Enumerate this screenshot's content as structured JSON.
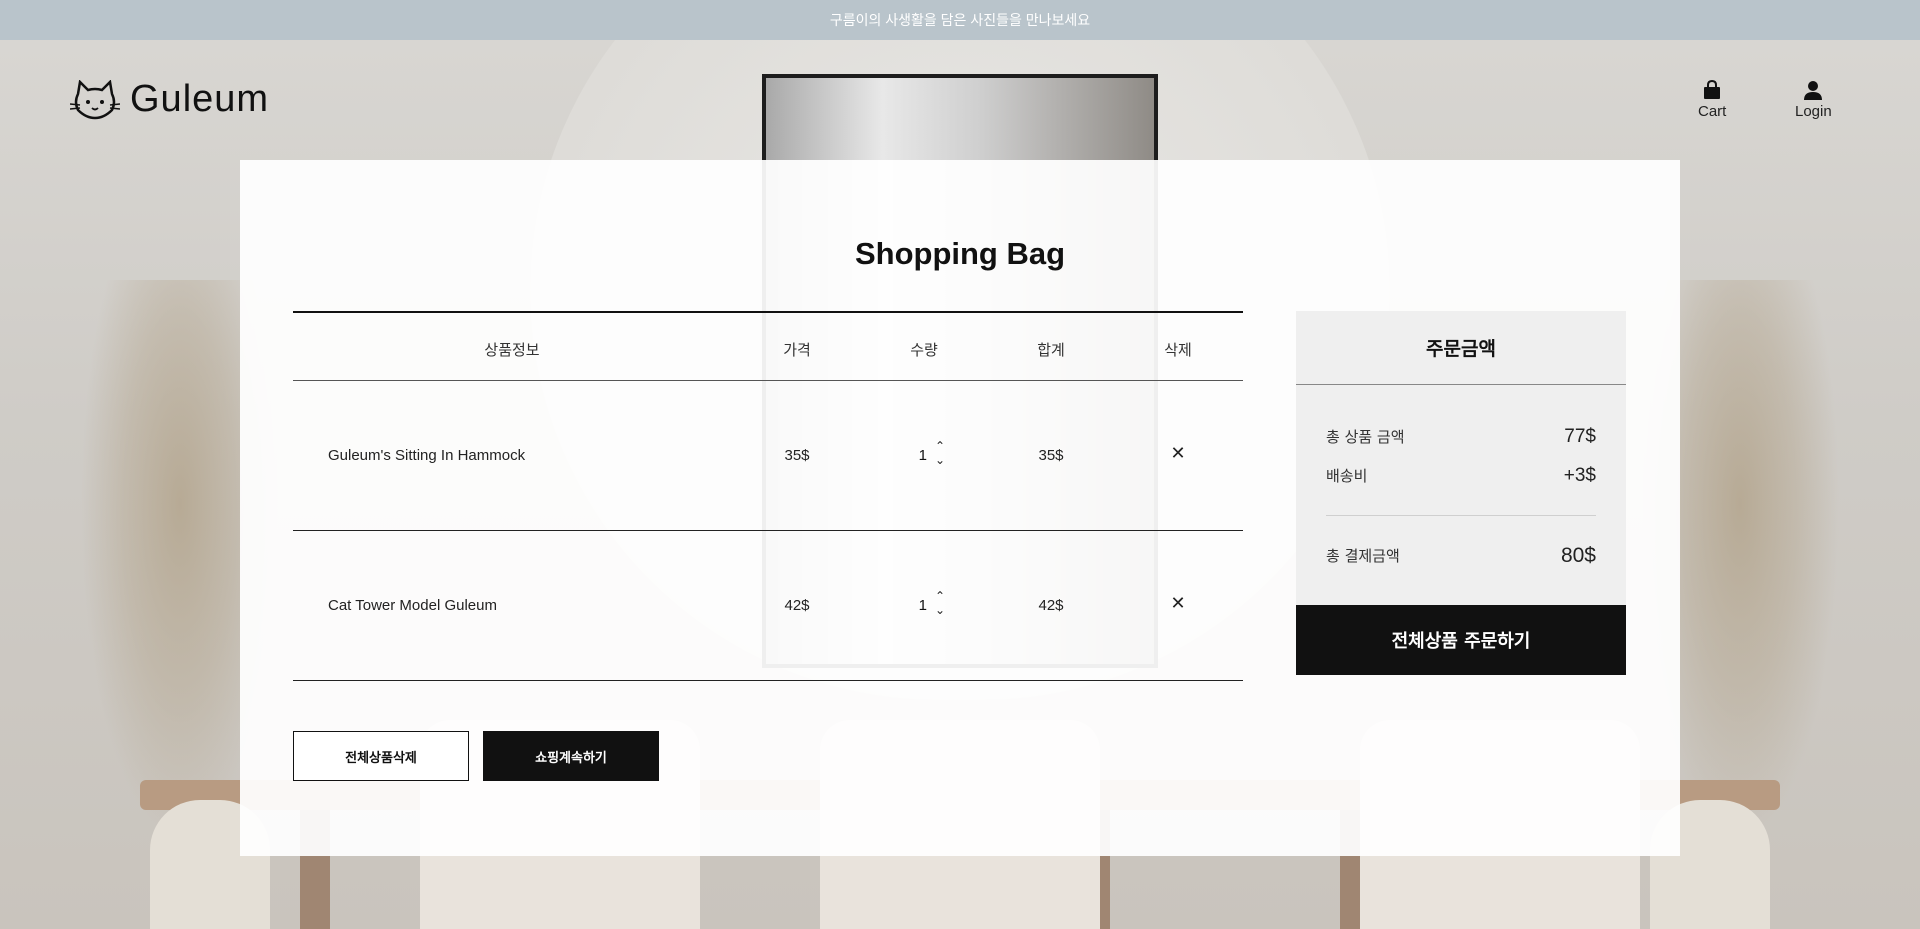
{
  "banner": {
    "text": "구름이의 사생활을 담은 사진들을 만나보세요"
  },
  "header": {
    "brand": "Guleum",
    "nav": {
      "cart_label": "Cart",
      "login_label": "Login"
    }
  },
  "page": {
    "title": "Shopping Bag"
  },
  "cart": {
    "columns": {
      "product": "상품정보",
      "price": "가격",
      "quantity": "수량",
      "total": "합계",
      "delete": "삭제"
    },
    "items": [
      {
        "name": "Guleum's Sitting In Hammock",
        "price": "35$",
        "quantity": "1",
        "total": "35$",
        "delete_symbol": "✕"
      },
      {
        "name": "Cat Tower Model Guleum",
        "price": "42$",
        "quantity": "1",
        "total": "42$",
        "delete_symbol": "✕"
      }
    ],
    "buttons": {
      "delete_all": "전체상품삭제",
      "continue_shopping": "쇼핑계속하기"
    }
  },
  "summary": {
    "title": "주문금액",
    "subtotal_label": "총 상품 금액",
    "subtotal_value": "77$",
    "shipping_label": "배송비",
    "shipping_value": "+3$",
    "total_label": "총 결제금액",
    "total_value": "80$",
    "order_button": "전체상품 주문하기"
  },
  "icons": {
    "cart": "shopping-bag-icon",
    "login": "user-icon",
    "logo": "cat-icon",
    "qty_up": "chevron-up-icon",
    "qty_down": "chevron-down-icon",
    "remove": "close-icon"
  },
  "colors": {
    "banner_bg": "#b9c4cb",
    "primary": "#111111",
    "summary_bg": "#efefef"
  }
}
